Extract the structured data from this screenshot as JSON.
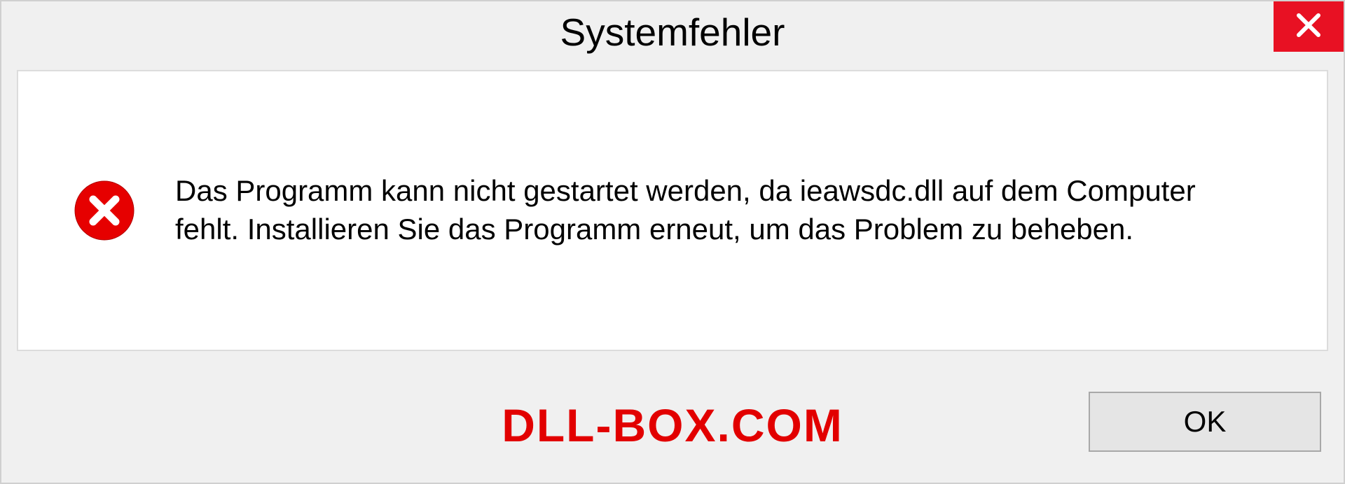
{
  "dialog": {
    "title": "Systemfehler",
    "message": "Das Programm kann nicht gestartet werden, da ieawsdc.dll auf dem Computer fehlt. Installieren Sie das Programm erneut, um das Problem zu beheben.",
    "ok_label": "OK"
  },
  "watermark": "DLL-BOX.COM"
}
